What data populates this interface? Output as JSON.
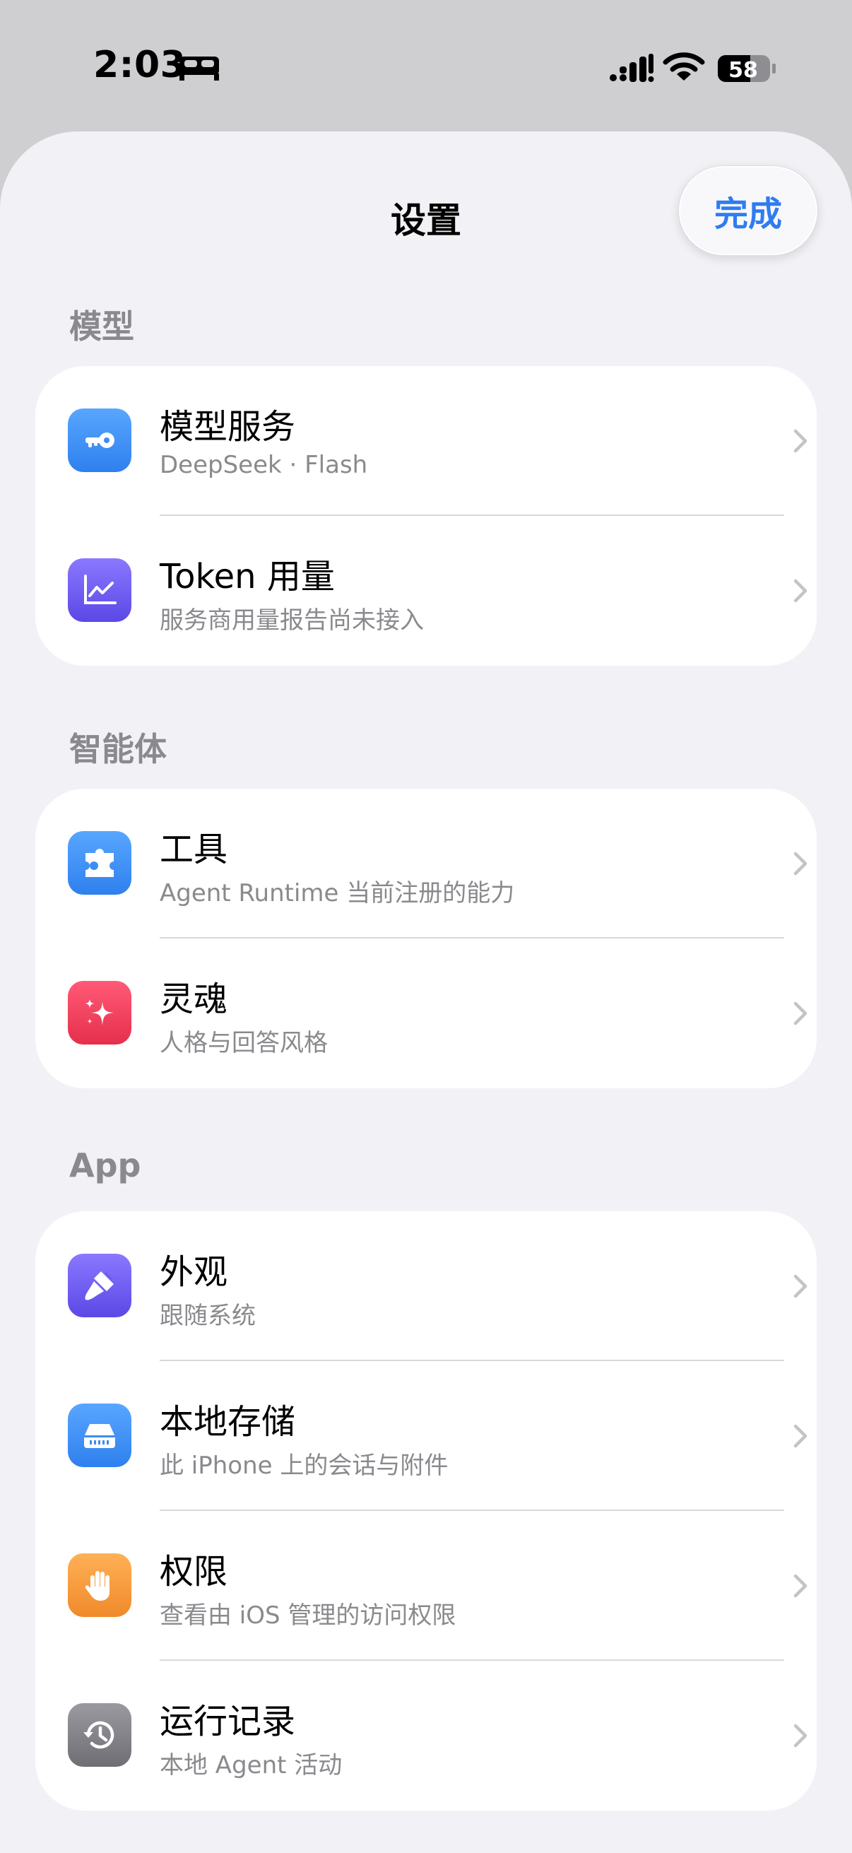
{
  "status": {
    "time": "2:03",
    "battery": "58"
  },
  "nav": {
    "title": "设置",
    "done_label": "完成"
  },
  "sections": [
    {
      "header": "模型",
      "rows": [
        {
          "title": "模型服务",
          "subtitle": "DeepSeek · Flash",
          "icon": "key-icon"
        },
        {
          "title": "Token 用量",
          "subtitle": "服务商用量报告尚未接入",
          "icon": "chart-icon"
        }
      ]
    },
    {
      "header": "智能体",
      "rows": [
        {
          "title": "工具",
          "subtitle": "Agent Runtime 当前注册的能力",
          "icon": "puzzle-icon"
        },
        {
          "title": "灵魂",
          "subtitle": "人格与回答风格",
          "icon": "sparkles-icon"
        }
      ]
    },
    {
      "header": "App",
      "rows": [
        {
          "title": "外观",
          "subtitle": "跟随系统",
          "icon": "paintbrush-icon"
        },
        {
          "title": "本地存储",
          "subtitle": "此 iPhone 上的会话与附件",
          "icon": "drive-icon"
        },
        {
          "title": "权限",
          "subtitle": "查看由 iOS 管理的访问权限",
          "icon": "hand-icon"
        },
        {
          "title": "运行记录",
          "subtitle": "本地 Agent 活动",
          "icon": "history-icon"
        }
      ]
    }
  ],
  "colors": {
    "accent": "#2f7cf0",
    "sheet_background": "#f2f2f6",
    "secondary_text": "#8a8a8e"
  }
}
